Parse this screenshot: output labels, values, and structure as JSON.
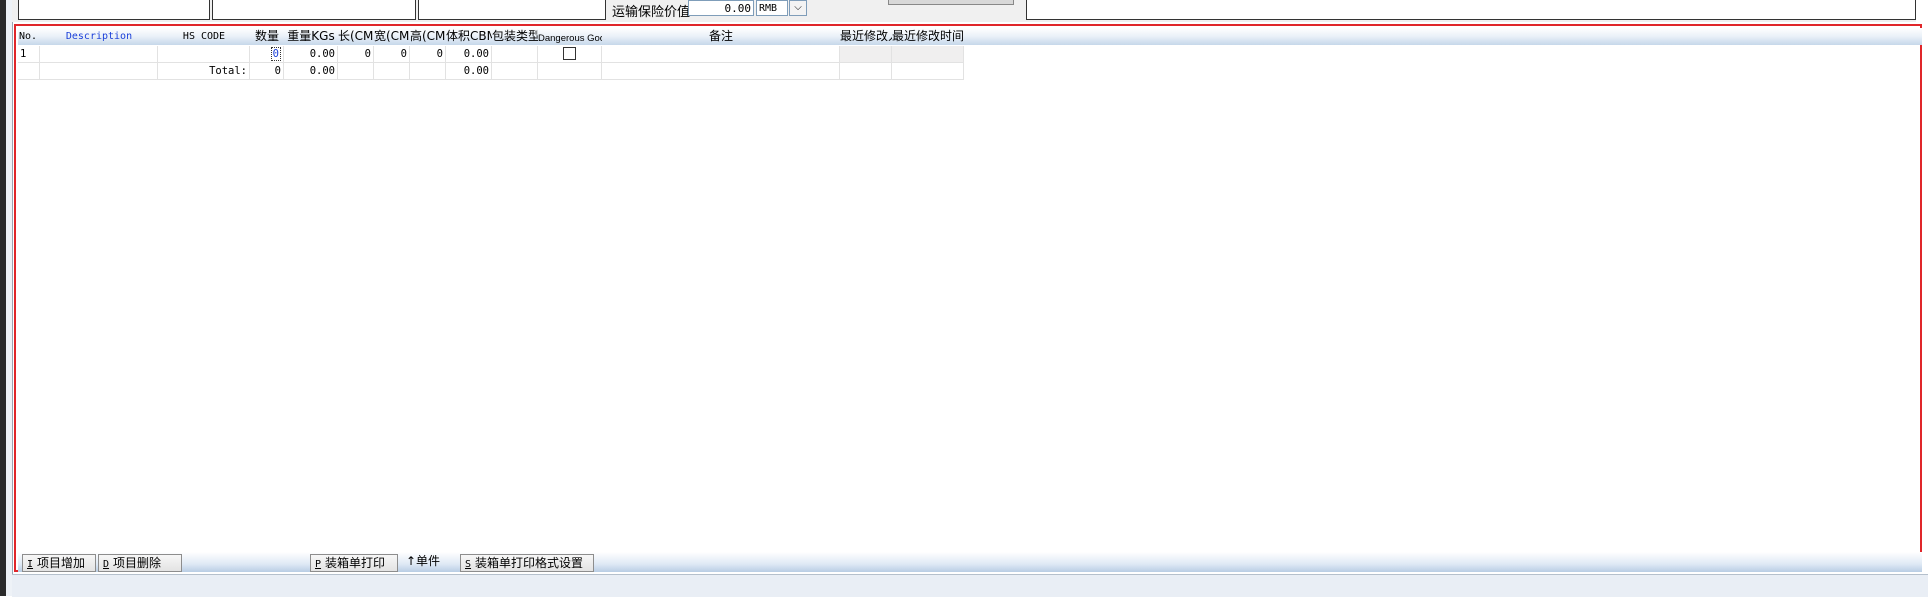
{
  "top_form": {
    "insurance_label": "运输保险价值",
    "insurance_value": "0.00",
    "currency": "RMB",
    "dropdown_glyph": "⌵"
  },
  "grid": {
    "columns": {
      "no": "No.",
      "description": "Description",
      "hs_code": "HS CODE",
      "qty": "数量",
      "weight": "重量KGs",
      "length": "长(CM)",
      "width": "宽(CM)",
      "height": "高(CM)",
      "volume": "体积CBM",
      "pack_type": "包装类型",
      "dangerous": "Dangerous Goods",
      "remarks": "备注",
      "modified_by": "最近修改人",
      "modified_time": "最近修改时间"
    },
    "rows": [
      {
        "no": "1",
        "description": "",
        "hs_code": "",
        "qty": "0",
        "weight": "0.00",
        "length": "0",
        "width": "0",
        "height": "0",
        "volume": "0.00",
        "pack_type": "",
        "dangerous": false,
        "remarks": "",
        "modified_by": "",
        "modified_time": ""
      }
    ],
    "total": {
      "label": "Total:",
      "qty": "0",
      "weight": "0.00",
      "volume": "0.00"
    }
  },
  "toolbar": {
    "add_item": {
      "key": "I",
      "label": "项目增加"
    },
    "delete_item": {
      "key": "D",
      "label": "项目删除"
    },
    "print_packing": {
      "key": "P",
      "label": "装箱单打印"
    },
    "unit_label": "↑单件",
    "print_format": {
      "key": "S",
      "label": "装箱单打印格式设置"
    }
  }
}
